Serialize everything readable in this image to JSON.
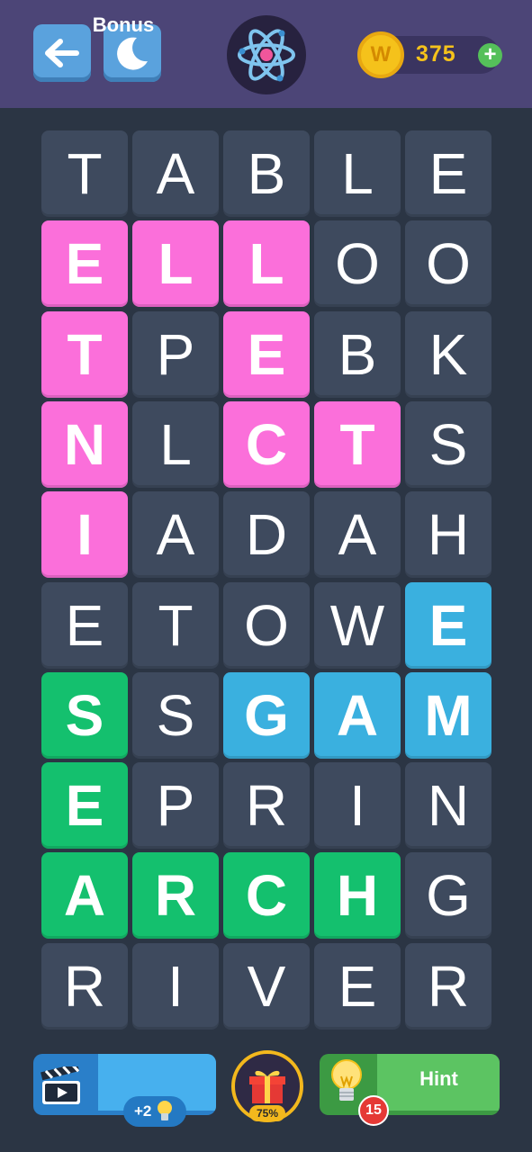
{
  "header": {
    "coins": "375",
    "coin_symbol": "W",
    "plus_symbol": "+"
  },
  "grid": {
    "rows": [
      [
        "T",
        "A",
        "B",
        "L",
        "E"
      ],
      [
        "E",
        "L",
        "L",
        "O",
        "O"
      ],
      [
        "T",
        "P",
        "E",
        "B",
        "K"
      ],
      [
        "N",
        "L",
        "C",
        "T",
        "S"
      ],
      [
        "I",
        "A",
        "D",
        "A",
        "H"
      ],
      [
        "E",
        "T",
        "O",
        "W",
        "E"
      ],
      [
        "S",
        "S",
        "G",
        "A",
        "M"
      ],
      [
        "E",
        "P",
        "R",
        "I",
        "N"
      ],
      [
        "A",
        "R",
        "C",
        "H",
        "G"
      ],
      [
        "R",
        "I",
        "V",
        "E",
        "R"
      ]
    ],
    "highlights": [
      [
        "",
        "",
        "",
        "",
        ""
      ],
      [
        "pink",
        "pink",
        "pink",
        "",
        ""
      ],
      [
        "pink",
        "",
        "pink",
        "",
        ""
      ],
      [
        "pink",
        "",
        "pink",
        "pink",
        ""
      ],
      [
        "pink",
        "",
        "",
        "",
        ""
      ],
      [
        "",
        "",
        "",
        "",
        "blue"
      ],
      [
        "green",
        "",
        "blue",
        "blue",
        "blue"
      ],
      [
        "green",
        "",
        "",
        "",
        ""
      ],
      [
        "green",
        "green",
        "green",
        "green",
        ""
      ],
      [
        "",
        "",
        "",
        "",
        ""
      ]
    ],
    "colors": {
      "tile": "#3e4a5e",
      "pink": "#fb6fda",
      "blue": "#3ab0df",
      "green": "#14c06e"
    }
  },
  "footer": {
    "bonus_label": "Bonus",
    "bonus_reward": "+2",
    "gift_progress": "75%",
    "hint_label": "Hint",
    "hint_count": "15"
  },
  "icons": [
    "arrow-left-icon",
    "moon-icon",
    "atom-icon",
    "coin-icon",
    "plus-icon",
    "clapperboard-icon",
    "lightbulb-icon",
    "gift-icon"
  ]
}
